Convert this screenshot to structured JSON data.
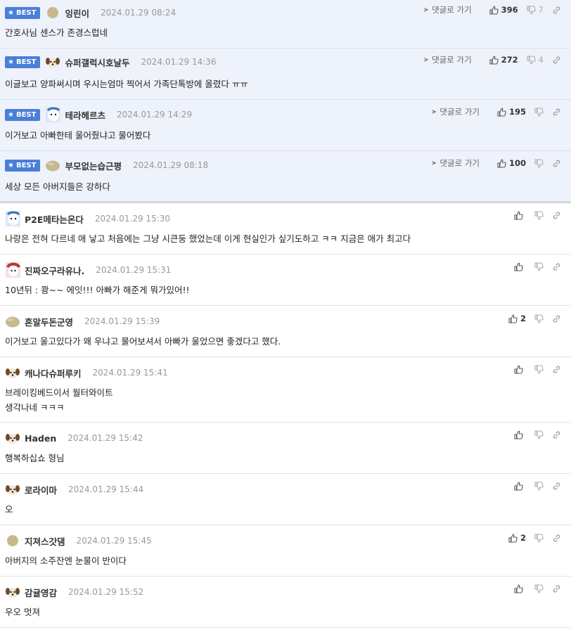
{
  "best_label": "BEST",
  "reply_label": "댓글로 가기",
  "best_comments": [
    {
      "nick": "잉린이",
      "date": "2024.01.29 08:24",
      "text": "간호사님 센스가 존경스럽네",
      "up": "396",
      "down": "7",
      "avatar": "tan-dot"
    },
    {
      "nick": "슈퍼갤럭시호날두",
      "date": "2024.01.29 14:36",
      "text": "이글보고 양파써시며 우시는엄마 찍어서 가족단톡방에 올렸다 ㅠㅠ",
      "up": "272",
      "down": "4",
      "avatar": "puppy"
    },
    {
      "nick": "테라헤르츠",
      "date": "2024.01.29 14:29",
      "text": "이거보고 아빠한테 울어줬냐고 물어봤다",
      "up": "195",
      "down": "",
      "avatar": "blue-character"
    },
    {
      "nick": "부모없는습근평",
      "date": "2024.01.29 08:18",
      "text": "세상 모든 아버지들은 강하다",
      "up": "100",
      "down": "",
      "avatar": "blob"
    }
  ],
  "comments": [
    {
      "nick": "P2E메타는온다",
      "date": "2024.01.29 15:30",
      "text": "나랑은 전혀 다르네 애 낳고 처음에는 그냥 시큰둥 했었는데 이게 현실인가 싶기도하고 ㅋㅋ 지금은 애가 최고다",
      "up": "",
      "avatar": "blue-character"
    },
    {
      "nick": "진짜오구라유나.",
      "date": "2024.01.29 15:31",
      "text": "10년뒤 : 쾅~~ 에잇!!! 아빠가 해준게 뭐가있어!!",
      "up": "",
      "avatar": "red-character"
    },
    {
      "nick": "혼알두돈군영",
      "date": "2024.01.29 15:39",
      "text": "이거보고 울고있다가 왜 우냐고 물어보셔서 아빠가 울었으면 좋겠다고 했다.",
      "up": "2",
      "avatar": "blob"
    },
    {
      "nick": "캐나다슈퍼루키",
      "date": "2024.01.29 15:41",
      "text": "브레이킹베드이서 월터와이트\n생각나네 ㅋㅋㅋ",
      "up": "",
      "avatar": "puppy"
    },
    {
      "nick": "Haden",
      "date": "2024.01.29 15:42",
      "text": "행복하십쇼 형님",
      "up": "",
      "avatar": "puppy"
    },
    {
      "nick": "로라이마",
      "date": "2024.01.29 15:44",
      "text": "오",
      "up": "",
      "avatar": "puppy"
    },
    {
      "nick": "지져스갓댐",
      "date": "2024.01.29 15:45",
      "text": "아버지의 소주잔엔 눈물이 반이다",
      "up": "2",
      "avatar": "tan-dot"
    },
    {
      "nick": "감귤영감",
      "date": "2024.01.29 15:52",
      "text": "우오 멋져",
      "up": "",
      "avatar": "puppy"
    }
  ],
  "icons": {
    "up": "thumbs-up-icon",
    "down": "thumbs-down-icon",
    "link": "link-icon",
    "reply": "reply-arrow-icon"
  },
  "colors": {
    "best_badge": "#4a7fd8",
    "best_bg": "#eef2fb"
  }
}
